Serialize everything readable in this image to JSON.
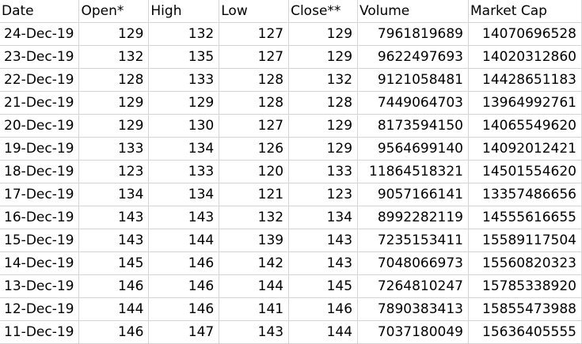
{
  "columns": [
    "Date",
    "Open*",
    "High",
    "Low",
    "Close**",
    "Volume",
    "Market Cap"
  ],
  "rows": [
    [
      "24-Dec-19",
      "129",
      "132",
      "127",
      "129",
      "7961819689",
      "14070696528"
    ],
    [
      "23-Dec-19",
      "132",
      "135",
      "127",
      "129",
      "9622497693",
      "14020312860"
    ],
    [
      "22-Dec-19",
      "128",
      "133",
      "128",
      "132",
      "9121058481",
      "14428651183"
    ],
    [
      "21-Dec-19",
      "129",
      "129",
      "128",
      "128",
      "7449064703",
      "13964992761"
    ],
    [
      "20-Dec-19",
      "129",
      "130",
      "127",
      "129",
      "8173594150",
      "14065549620"
    ],
    [
      "19-Dec-19",
      "133",
      "134",
      "126",
      "129",
      "9564699140",
      "14092012421"
    ],
    [
      "18-Dec-19",
      "123",
      "133",
      "120",
      "133",
      "11864518321",
      "14501554620"
    ],
    [
      "17-Dec-19",
      "134",
      "134",
      "121",
      "123",
      "9057166141",
      "13357486656"
    ],
    [
      "16-Dec-19",
      "143",
      "143",
      "132",
      "134",
      "8992282119",
      "14555616655"
    ],
    [
      "15-Dec-19",
      "143",
      "144",
      "139",
      "143",
      "7235153411",
      "15589117504"
    ],
    [
      "14-Dec-19",
      "145",
      "146",
      "142",
      "143",
      "7048066973",
      "15560820323"
    ],
    [
      "13-Dec-19",
      "146",
      "146",
      "144",
      "145",
      "7264810247",
      "15785338920"
    ],
    [
      "12-Dec-19",
      "144",
      "146",
      "141",
      "146",
      "7890383413",
      "15855473988"
    ],
    [
      "11-Dec-19",
      "146",
      "147",
      "143",
      "144",
      "7037180049",
      "15636405555"
    ]
  ]
}
